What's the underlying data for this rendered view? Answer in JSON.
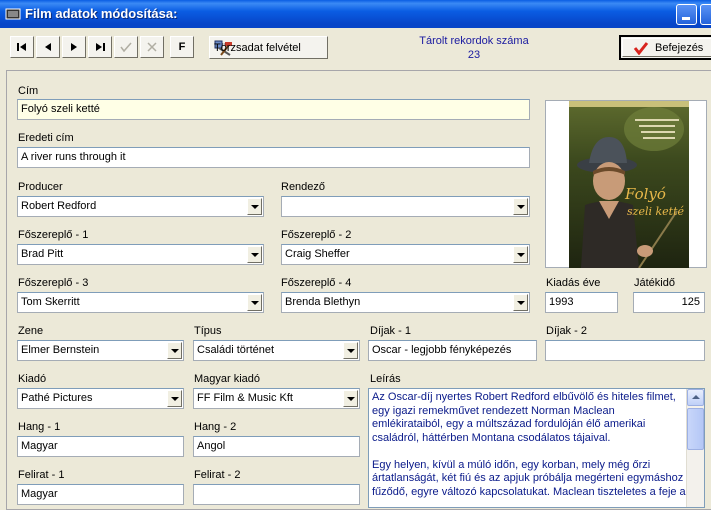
{
  "window": {
    "title": "Film adatok módosítása:"
  },
  "toolbar": {
    "f_label": "F",
    "torzsadat_label": "Törzsadat felvétel",
    "record_count_label": "Tárolt rekordok száma",
    "record_count": "23",
    "finish_label": "Befejezés"
  },
  "labels": {
    "cim": "Cím",
    "eredeti_cim": "Eredeti cím",
    "producer": "Producer",
    "rendezo": "Rendező",
    "foszereplo1": "Főszereplő - 1",
    "foszereplo2": "Főszereplő - 2",
    "foszereplo3": "Főszereplő - 3",
    "foszereplo4": "Főszereplő - 4",
    "kiadas_eve": "Kiadás éve",
    "jatekido": "Játékidő",
    "zene": "Zene",
    "tipus": "Típus",
    "dijak1": "Díjak - 1",
    "dijak2": "Díjak - 2",
    "kiado": "Kiadó",
    "magyar_kiado": "Magyar kiadó",
    "leiras": "Leírás",
    "hang1": "Hang - 1",
    "hang2": "Hang - 2",
    "felirat1": "Felirat - 1",
    "felirat2": "Felirat - 2"
  },
  "values": {
    "cim": "Folyó szeli ketté",
    "eredeti_cim": "A river runs through it",
    "producer": "Robert Redford",
    "rendezo": "",
    "foszereplo1": "Brad Pitt",
    "foszereplo2": "Craig Sheffer",
    "foszereplo3": "Tom Skerritt",
    "foszereplo4": "Brenda Blethyn",
    "kiadas_eve": "1993",
    "jatekido": "125",
    "zene": "Elmer Bernstein",
    "tipus": "Családi történet",
    "dijak1": "Oscar - legjobb fényképezés",
    "dijak2": "",
    "kiado": "Pathé Pictures",
    "magyar_kiado": "FF Film & Music Kft",
    "hang1": "Magyar",
    "hang2": "Angol",
    "felirat1": "Magyar",
    "felirat2": ""
  },
  "poster": {
    "title_text": "Folyó szeli ketté"
  },
  "leiras": "Az Oscar-díj nyertes Robert Redford elbűvölő és hiteles filmet, egy igazi remekművet rendezett Norman Maclean emlékirataiból, egy a múltszázad fordulóján élő amerikai családról, háttérben Montana csodálatos tájaival.\n\nEgy helyen, kívül a múló időn, egy korban, mely még őrzi ártatlanságát, két fiú és az apjuk próbálja megérteni egymáshoz fűződő, egyre változó kapcsolatukat. Maclean tiszteletes a feje a"
}
